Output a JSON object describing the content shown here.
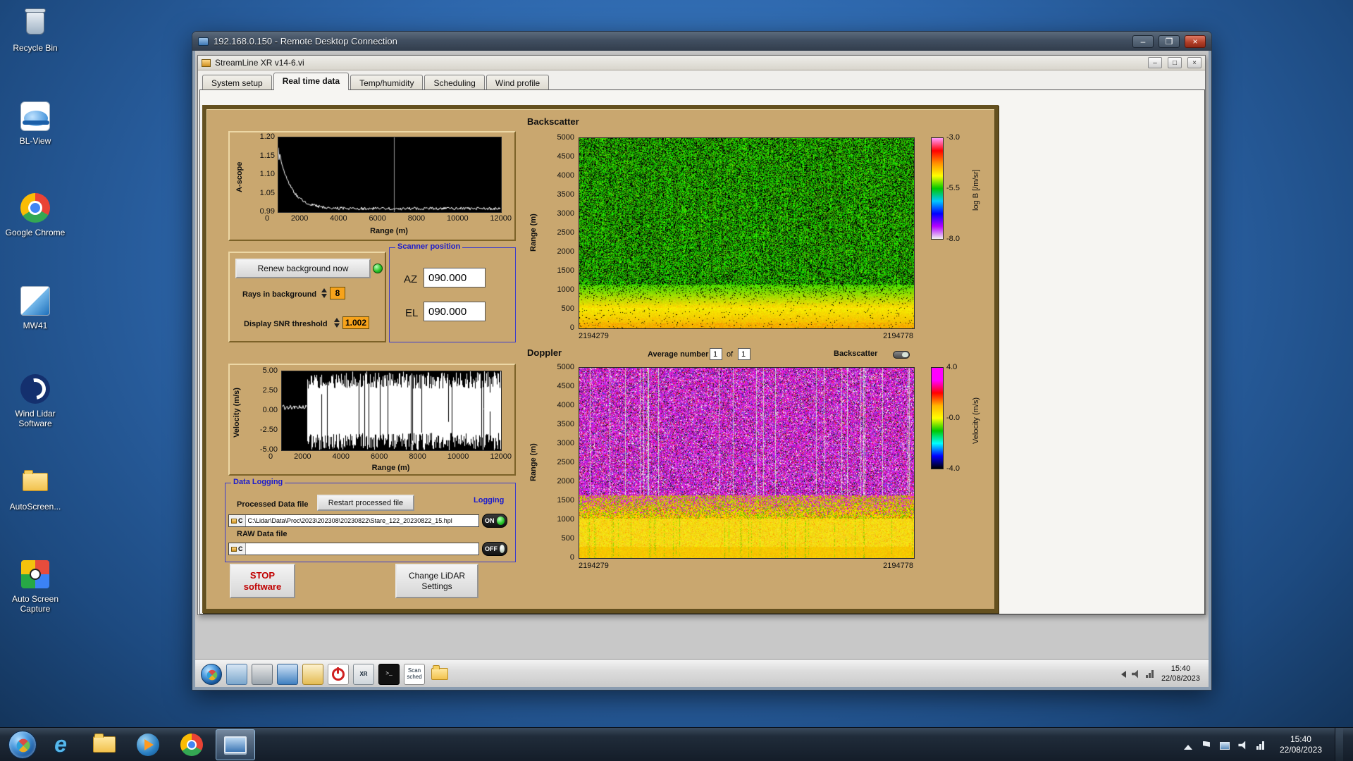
{
  "desktop": {
    "icons": [
      {
        "label": "Recycle Bin"
      },
      {
        "label": "BL-View"
      },
      {
        "label": "Google Chrome"
      },
      {
        "label": "MW41"
      },
      {
        "label": "Wind Lidar Software"
      },
      {
        "label": "AutoScreen..."
      },
      {
        "label": "Auto Screen Capture"
      }
    ],
    "taskbar": {
      "time": "15:40",
      "date": "22/08/2023"
    }
  },
  "rdp": {
    "title": "192.168.0.150 - Remote Desktop Connection",
    "taskbar": {
      "time": "15:40",
      "date": "22/08/2023",
      "scan_label": "Scan sched",
      "xr_label": "XR"
    }
  },
  "app": {
    "title": "StreamLine XR v14-6.vi",
    "tabs": [
      "System setup",
      "Real time data",
      "Temp/humidity",
      "Scheduling",
      "Wind profile"
    ],
    "controls": {
      "renew_button": "Renew background now",
      "rays_label": "Rays in background",
      "rays_value": "8",
      "snr_label": "Display SNR threshold",
      "snr_value": "1.002",
      "scanner_title": "Scanner position",
      "az_label": "AZ",
      "az_value": "090.000",
      "el_label": "EL",
      "el_value": "090.000",
      "average_label": "Average number",
      "average_value": "1",
      "of_label": "of",
      "average_total": "1",
      "backscatter_toggle_label": "Backscatter",
      "stop_line1": "STOP",
      "stop_line2": "software",
      "change_line1": "Change LiDAR",
      "change_line2": "Settings"
    },
    "data_logging": {
      "title": "Data Logging",
      "processed_label": "Processed Data file",
      "restart_button": "Restart processed file",
      "drive": "C",
      "processed_path": "C:\\Lidar\\Data\\Proc\\2023\\202308\\20230822\\Stare_122_20230822_15.hpl",
      "logging_label": "Logging",
      "on_label": "ON",
      "raw_label": "RAW Data file",
      "raw_path": "",
      "off_label": "OFF"
    }
  },
  "chart_data": [
    {
      "type": "line",
      "name": "a-scope",
      "ylabel": "A-scope",
      "xlabel": "Range (m)",
      "ylim": [
        0.99,
        1.2
      ],
      "xlim": [
        0,
        12000
      ],
      "y_ticks": [
        "1.20",
        "1.15",
        "1.10",
        "1.05",
        "0.99"
      ],
      "x_ticks": [
        "0",
        "2000",
        "4000",
        "6000",
        "8000",
        "10000",
        "12000"
      ],
      "series": [
        {
          "name": "background",
          "x": [
            0,
            200,
            500,
            1000,
            1500,
            2000,
            3000,
            6000,
            9000,
            12000
          ],
          "y": [
            1.17,
            1.09,
            1.05,
            1.02,
            1.005,
            1.0,
            1.0,
            1.0,
            1.0,
            1.0
          ]
        }
      ],
      "note": "white trace on black, ~0.005 noise, faint vertical cursor near 6200 m"
    },
    {
      "type": "line",
      "name": "velocity",
      "ylabel": "Velocity (m/s)",
      "xlabel": "Range (m)",
      "ylim": [
        -5,
        5
      ],
      "xlim": [
        0,
        12000
      ],
      "y_ticks": [
        "5.00",
        "2.50",
        "0.00",
        "-2.50",
        "-5.00"
      ],
      "x_ticks": [
        "0",
        "2000",
        "4000",
        "6000",
        "8000",
        "10000",
        "12000"
      ],
      "note": "coherent ~0.5 m/s below 1500 m, full-scale random vertical noise lines beyond"
    },
    {
      "type": "heatmap",
      "name": "backscatter",
      "title": "Backscatter",
      "ylabel": "Range (m)",
      "ylim": [
        0,
        5000
      ],
      "y_ticks": [
        "5000",
        "4500",
        "4000",
        "3500",
        "3000",
        "2500",
        "2000",
        "1500",
        "1000",
        "500",
        "0"
      ],
      "x_start": "2194279",
      "x_end": "2194778",
      "colorbar_label": "log B [/m/sr]",
      "colorbar_ticks": [
        "-3.0",
        "-5.5",
        "-8.0"
      ],
      "colorbar_colors": [
        "#ff9cff",
        "#ff0000",
        "#ff9000",
        "#ffff00",
        "#00c800",
        "#00c8ff",
        "#0000ff",
        "#b400ff",
        "#f0f0f0"
      ],
      "bands": [
        {
          "range_m": [
            1200,
            5000
          ],
          "appearance": "green with dense black speckle (noise)"
        },
        {
          "range_m": [
            500,
            1200
          ],
          "appearance": "green-to-yellow transition"
        },
        {
          "range_m": [
            0,
            500
          ],
          "appearance": "bright yellow-orange aerosol layer"
        }
      ]
    },
    {
      "type": "heatmap",
      "name": "doppler",
      "title": "Doppler",
      "ylabel": "Range (m)",
      "ylim": [
        0,
        5000
      ],
      "y_ticks": [
        "5000",
        "4500",
        "4000",
        "3500",
        "3000",
        "2500",
        "2000",
        "1500",
        "1000",
        "500",
        "0"
      ],
      "x_start": "2194279",
      "x_end": "2194778",
      "colorbar_label": "Velocity (m/s)",
      "colorbar_ticks": [
        "4.0",
        "-0.0",
        "-4.0"
      ],
      "colorbar_colors": [
        "#ff00ff",
        "#ff00ff",
        "#ff0000",
        "#ffb400",
        "#ffff00",
        "#00c800",
        "#00ffff",
        "#0000ff",
        "#000000"
      ],
      "bands": [
        {
          "range_m": [
            1700,
            5000
          ],
          "appearance": "magenta noise with grey/white vertical streaks"
        },
        {
          "range_m": [
            1100,
            1700
          ],
          "appearance": "mixed magenta-green-red transition"
        },
        {
          "range_m": [
            0,
            1100
          ],
          "appearance": "yellow (~-0.5 m/s) with green patches"
        }
      ]
    }
  ]
}
